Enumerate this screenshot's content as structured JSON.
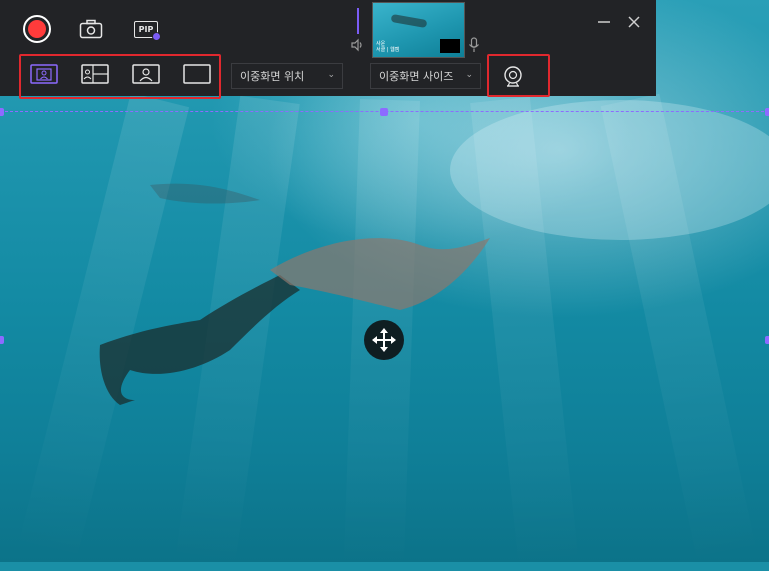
{
  "toolbar": {
    "record_icon": "record-icon",
    "camera_icon": "screenshot-camera-icon",
    "pip_label": "PIP",
    "speaker_icon": "speaker-icon",
    "mic_icon": "microphone-icon",
    "minimize_icon": "minimize-icon",
    "close_icon": "close-icon",
    "preview": {
      "caption_line1": "사운",
      "caption_line2": "서클 | 웹캠"
    },
    "layouts": [
      {
        "icon": "pip-corner-layout-icon"
      },
      {
        "icon": "side-by-side-layout-icon"
      },
      {
        "icon": "webcam-only-layout-icon"
      },
      {
        "icon": "screen-only-layout-icon"
      }
    ],
    "position_dropdown": {
      "value": "이중화면 위치"
    },
    "size_dropdown": {
      "value": "이중화면 사이즈"
    },
    "webcam_icon": "webcam-icon"
  },
  "colors": {
    "toolbar_bg": "#222326",
    "accent": "#7b5cf5",
    "record": "#ff3b3b",
    "highlight_box": "#e0282e"
  },
  "canvas": {
    "move_icon": "move-arrows-icon"
  }
}
